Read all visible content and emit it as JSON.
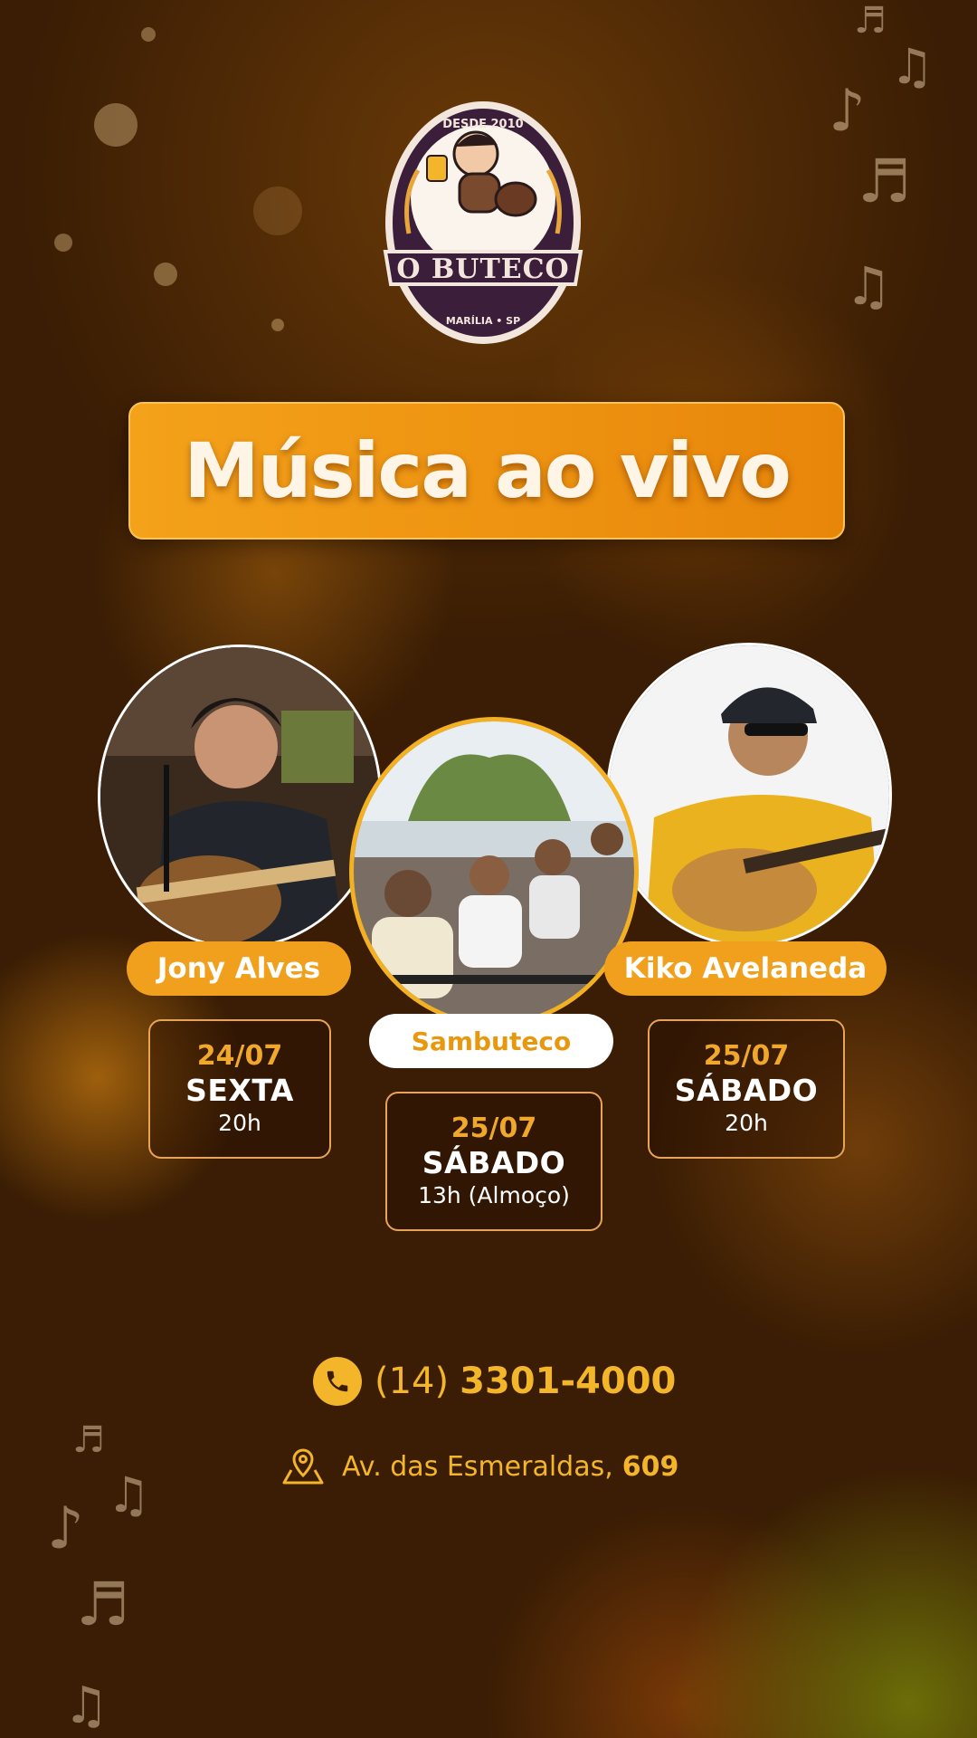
{
  "logo": {
    "top_text": "DESDE 2010",
    "name": "O BUTECO",
    "location": "MARÍLIA • SP"
  },
  "title": "Música ao vivo",
  "events": [
    {
      "artist": "Jony Alves",
      "date": "24/07",
      "day": "SEXTA",
      "time": "20h"
    },
    {
      "artist": "Sambuteco",
      "date": "25/07",
      "day": "SÁBADO",
      "time": "13h (Almoço)"
    },
    {
      "artist": "Kiko Avelaneda",
      "date": "25/07",
      "day": "SÁBADO",
      "time": "20h"
    }
  ],
  "contact": {
    "phone_prefix": "(14)",
    "phone_number": "3301-4000",
    "address": "Av. das Esmeraldas,",
    "address_number": "609"
  },
  "icons": {
    "phone": "phone-icon",
    "location": "map-pin-icon",
    "notes": "music-note-icon"
  },
  "colors": {
    "accent": "#f0a01c",
    "banner": "#e8860a",
    "text_gold": "#f3b52a",
    "background": "#3a1d04"
  }
}
